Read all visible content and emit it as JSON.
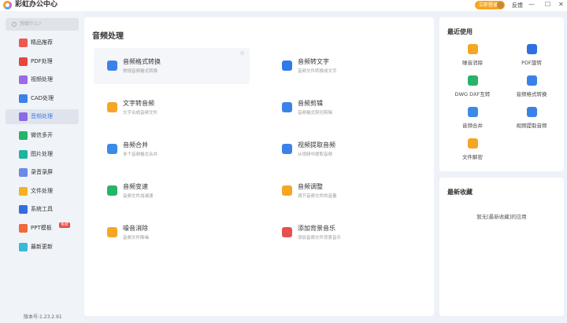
{
  "app": {
    "title": "彩虹办公中心",
    "login": "立即登录",
    "feedback": "反馈",
    "min": "—",
    "max": "☐",
    "close": "✕"
  },
  "sidebar": {
    "search_placeholder": "想做什么?",
    "version": "版本号:1.23.2.91",
    "items": [
      {
        "label": "精品推荐",
        "color": "#e85a4f"
      },
      {
        "label": "PDF处理",
        "color": "#e8453c"
      },
      {
        "label": "视频处理",
        "color": "#9b6ae8"
      },
      {
        "label": "CAD处理",
        "color": "#3b82e8"
      },
      {
        "label": "音频处理",
        "color": "#8a6ae8",
        "active": true
      },
      {
        "label": "微信多开",
        "color": "#27b36a"
      },
      {
        "label": "图片处理",
        "color": "#20b3a0"
      },
      {
        "label": "录音录屏",
        "color": "#6a8ae8"
      },
      {
        "label": "文件处理",
        "color": "#f5b021"
      },
      {
        "label": "系统工具",
        "color": "#2f6fe0"
      },
      {
        "label": "PPT模板",
        "color": "#ee6a3a",
        "badge": "免费"
      },
      {
        "label": "最新更新",
        "color": "#3ab8d8"
      }
    ]
  },
  "main": {
    "title": "音频处理",
    "tools": [
      {
        "title": "音频格式转换",
        "sub": "常规音频格式转换",
        "color": "#3b82e8"
      },
      {
        "title": "音频转文字",
        "sub": "音频文件转换成文字",
        "color": "#2f7be8"
      },
      {
        "title": "文字转音频",
        "sub": "文字合成音频文件",
        "color": "#f5a623"
      },
      {
        "title": "音频剪辑",
        "sub": "音频格式剪切剪辑",
        "color": "#3b82e8"
      },
      {
        "title": "音频合并",
        "sub": "多个音频格式合并",
        "color": "#3b8ae8"
      },
      {
        "title": "视频提取音频",
        "sub": "从视频中提取音频",
        "color": "#3b82e8"
      },
      {
        "title": "音频变速",
        "sub": "音频文件加减速",
        "color": "#27b36a"
      },
      {
        "title": "音频调整",
        "sub": "调节音频文件的音量",
        "color": "#f5a623"
      },
      {
        "title": "噪音消除",
        "sub": "音频文件降噪",
        "color": "#f5a623"
      },
      {
        "title": "添加背景音乐",
        "sub": "添加音频文件背景音乐",
        "color": "#e85050"
      }
    ]
  },
  "recent": {
    "title": "最近使用",
    "items": [
      {
        "label": "噪音消除",
        "color": "#f5a623"
      },
      {
        "label": "PDF旋转",
        "color": "#2f6fe0"
      },
      {
        "label": "DWG DXF互转",
        "color": "#27b36a"
      },
      {
        "label": "音频格式转换",
        "color": "#3b82e8"
      },
      {
        "label": "音频合并",
        "color": "#3b8ae8"
      },
      {
        "label": "视频提取音频",
        "color": "#3b82e8"
      },
      {
        "label": "文件解密",
        "color": "#f5a623"
      }
    ]
  },
  "favorites": {
    "title": "最新收藏",
    "empty": "暂无[最新收藏]的应用"
  }
}
